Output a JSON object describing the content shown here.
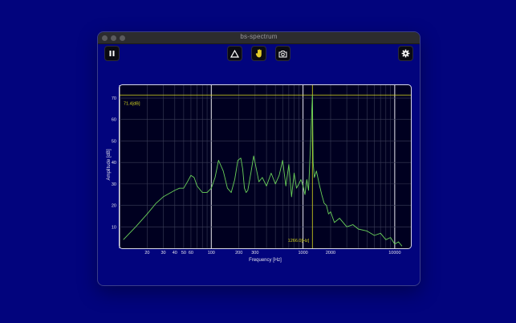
{
  "window": {
    "title": "bs-spectrum"
  },
  "toolbar": {
    "pause_icon": "pause-icon",
    "peak_icon": "triangle-icon",
    "hold_icon": "hand-icon",
    "snapshot_icon": "camera-icon",
    "settings_icon": "gear-icon"
  },
  "colors": {
    "background": "#02047d",
    "plot_background": "#000020",
    "trace": "#6ad15a",
    "marker": "#d6d61e",
    "highlight_button": "#e2cc2a"
  },
  "chart_data": {
    "type": "line",
    "xscale": "log",
    "xlim": [
      10,
      15000
    ],
    "ylim": [
      0,
      76
    ],
    "xlabel": "Frequency [Hz]",
    "ylabel": "Amplitude [dB]",
    "xticks": [
      20,
      30,
      40,
      50,
      60,
      100,
      200,
      300,
      1000,
      2000,
      10000
    ],
    "yticks": [
      10,
      20,
      30,
      40,
      50,
      60,
      70
    ],
    "grid": true,
    "peak_marker": {
      "frequency": 1266.0,
      "amplitude": 71.4,
      "frequency_label": "1266.0[Hz]",
      "amplitude_label": "71.4[dB]"
    },
    "series": [
      {
        "x": [
          11,
          15,
          20,
          25,
          30,
          40,
          45,
          50,
          55,
          60,
          65,
          70,
          80,
          90,
          100,
          110,
          120,
          135,
          150,
          165,
          180,
          195,
          210,
          220,
          230,
          240,
          250,
          270,
          290,
          300,
          330,
          360,
          400,
          450,
          500,
          550,
          600,
          650,
          700,
          750,
          800,
          850,
          900,
          950,
          1000,
          1050,
          1100,
          1150,
          1200,
          1240,
          1266,
          1290,
          1330,
          1400,
          1500,
          1600,
          1700,
          1800,
          1900,
          2000,
          2200,
          2500,
          3000,
          3500,
          4000,
          5000,
          6000,
          7000,
          8000,
          9000,
          10000,
          11000,
          12000
        ],
        "y": [
          4,
          10,
          16,
          21,
          24,
          27,
          28,
          28,
          31,
          34,
          33,
          29,
          26,
          26,
          28,
          33,
          41,
          36,
          28,
          26,
          32,
          41,
          42,
          37,
          28,
          26,
          27,
          35,
          43,
          40,
          31,
          33,
          29,
          35,
          30,
          34,
          41,
          29,
          39,
          24,
          35,
          28,
          30,
          32,
          29,
          25,
          32,
          27,
          45,
          62,
          71.4,
          40,
          33,
          36,
          30,
          25,
          21,
          20,
          16,
          17,
          12,
          14,
          10,
          11,
          9,
          8,
          6,
          7,
          4,
          5,
          2,
          3,
          1
        ]
      }
    ]
  }
}
